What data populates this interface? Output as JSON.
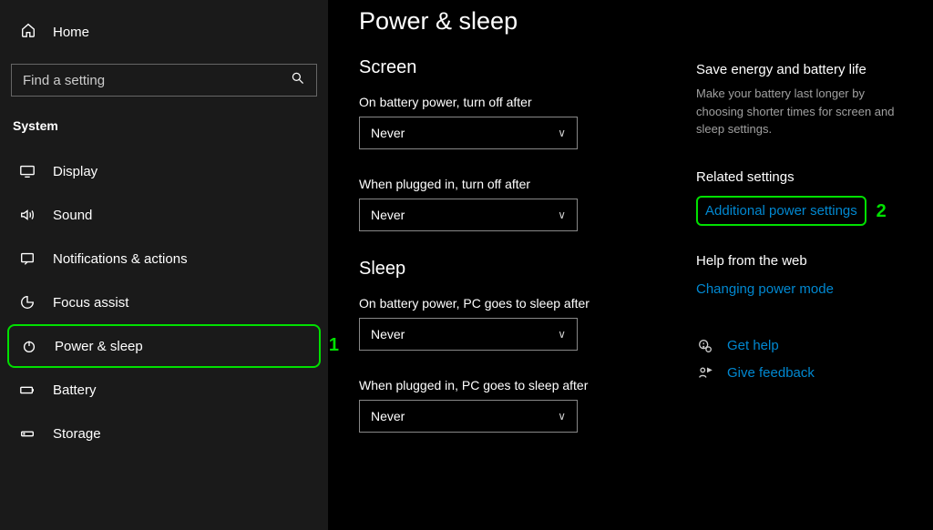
{
  "sidebar": {
    "home": "Home",
    "search_placeholder": "Find a setting",
    "section": "System",
    "items": [
      {
        "label": "Display"
      },
      {
        "label": "Sound"
      },
      {
        "label": "Notifications & actions"
      },
      {
        "label": "Focus assist"
      },
      {
        "label": "Power & sleep"
      },
      {
        "label": "Battery"
      },
      {
        "label": "Storage"
      }
    ],
    "annotation1": "1"
  },
  "page": {
    "title": "Power & sleep",
    "screen": {
      "heading": "Screen",
      "battery_label": "On battery power, turn off after",
      "battery_value": "Never",
      "plugged_label": "When plugged in, turn off after",
      "plugged_value": "Never"
    },
    "sleep": {
      "heading": "Sleep",
      "battery_label": "On battery power, PC goes to sleep after",
      "battery_value": "Never",
      "plugged_label": "When plugged in, PC goes to sleep after",
      "plugged_value": "Never"
    }
  },
  "aside": {
    "save_title": "Save energy and battery life",
    "save_desc": "Make your battery last longer by choosing shorter times for screen and sleep settings.",
    "related_title": "Related settings",
    "related_link": "Additional power settings",
    "annotation2": "2",
    "help_title": "Help from the web",
    "help_link": "Changing power mode",
    "get_help": "Get help",
    "give_feedback": "Give feedback"
  }
}
